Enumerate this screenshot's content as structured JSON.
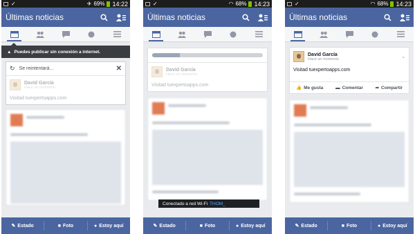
{
  "colors": {
    "brand": "#4a65a0",
    "battery": "#7cc400",
    "toast_ssid": "#58a9ff"
  },
  "screens": [
    {
      "status": {
        "battery": "69%",
        "time": "14:22"
      },
      "title": "Últimas noticias",
      "banner": "Puedes publicar sin conexión a internet.",
      "retry_text": "Se reintentará...",
      "post": {
        "name": "David García",
        "meta": "Hace un momento",
        "text": "Visitad tuexpertoapps.com"
      },
      "bottom": {
        "estado": "Estado",
        "foto": "Foto",
        "estoy": "Estoy aquí"
      }
    },
    {
      "status": {
        "battery": "68%",
        "time": "14:23"
      },
      "title": "Últimas noticias",
      "progress": 0.25,
      "post": {
        "name": "David García",
        "meta": "Hace un momento",
        "text": "Visitad tuexpertoapps.com"
      },
      "toast": {
        "text": "Conectado a red Wi-Fi",
        "ssid": "THOM_"
      },
      "bottom": {
        "estado": "Estado",
        "foto": "Foto",
        "estoy": "Estoy aquí"
      }
    },
    {
      "status": {
        "battery": "68%",
        "time": "14:23"
      },
      "title": "Últimas noticias",
      "post": {
        "name": "David García",
        "meta": "Hace un momento",
        "text": "Visitad tuexpertoapps.com"
      },
      "actions": {
        "like": "Me gusta",
        "comment": "Comentar",
        "share": "Compartir"
      },
      "bottom": {
        "estado": "Estado",
        "foto": "Foto",
        "estoy": "Estoy aquí"
      }
    }
  ],
  "icons": [
    "search-icon",
    "friend-requests-icon",
    "news-feed-icon",
    "friends-icon",
    "messages-icon",
    "globe-icon",
    "menu-icon",
    "refresh-icon",
    "close-icon",
    "camera-icon",
    "location-pin-icon",
    "edit-icon",
    "like-icon",
    "comment-icon",
    "share-icon"
  ]
}
